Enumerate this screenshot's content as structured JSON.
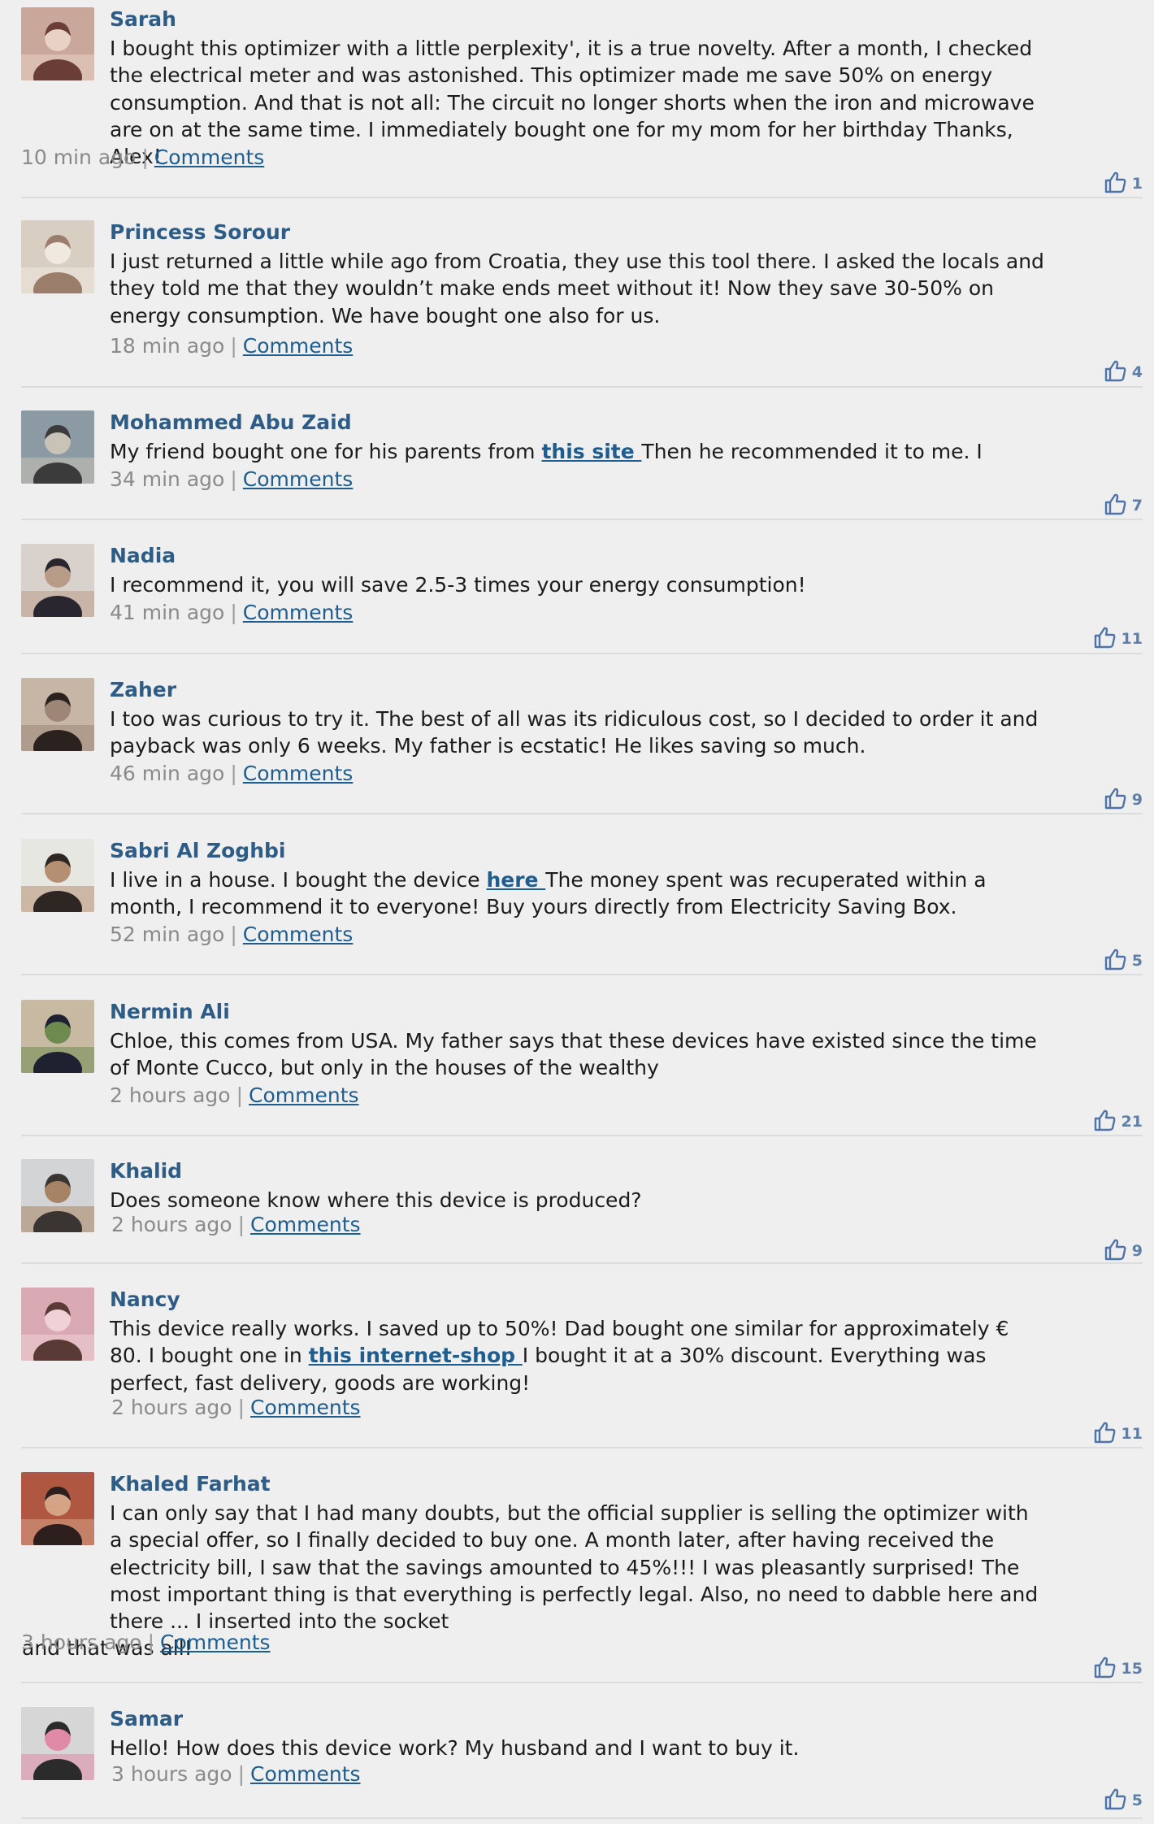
{
  "comments_label": "Comments",
  "comments": [
    {
      "author": "Sarah",
      "text": "I bought this optimizer with a little perplexity', it is a true novelty. After a month, I checked the electrical meter and was astonished. This optimizer made me save 50% on energy consumption. And that is not all: The circuit no longer shorts when the iron and microwave are on at the same time. I immediately bought one for my mom for her birthday Thanks, Alex!",
      "time": "10 min ago",
      "likes": "1"
    },
    {
      "author": "Princess Sorour",
      "text": "I just returned a little while ago from Croatia, they use this tool there. I asked the locals and they told me that they wouldn’t make ends meet without it! Now they save 30-50% on energy consumption. We have bought one also for us.",
      "time": "18 min ago",
      "likes": "4"
    },
    {
      "author": "Mohammed Abu Zaid",
      "text_before": "My friend bought one for his parents from ",
      "link": "this site ",
      "text_after": "Then he recommended it to me. I",
      "time": "34 min ago",
      "likes": "7"
    },
    {
      "author": "Nadia",
      "text": "I recommend it, you will save 2.5-3 times your energy consumption!",
      "time": "41 min ago",
      "likes": "11"
    },
    {
      "author": "Zaher",
      "text": "I too was curious to try it. The best of all was its ridiculous cost, so I decided to order it and payback was only 6 weeks. My father is ecstatic! He likes saving so much.",
      "time": "46 min ago",
      "likes": "9"
    },
    {
      "author": "Sabri Al Zoghbi",
      "text_before": "I live in a house. I bought the device ",
      "link": "here ",
      "text_after": "The money spent was recuperated within a month, I recommend it to everyone! Buy yours directly from Electricity Saving Box.",
      "time": "52 min ago",
      "likes": "5"
    },
    {
      "author": "Nermin Ali",
      "text": "Chloe, this comes from USA. My father says that these devices have existed since the time of Monte Cucco, but only in the houses of the wealthy",
      "time": "2 hours ago",
      "likes": "21"
    },
    {
      "author": "Khalid",
      "text": "Does someone know where this device is produced?",
      "time": "2 hours ago",
      "likes": "9"
    },
    {
      "author": "Nancy",
      "text_before": "This device really works. I saved up to 50%! Dad bought one similar for approximately € 80. I bought one in ",
      "link": "this internet-shop ",
      "text_after": "I bought it at a 30% discount. Everything was perfect, fast delivery, goods are working!",
      "time": "2 hours ago",
      "likes": "11"
    },
    {
      "author": "Khaled Farhat",
      "text": "I can only say that I had many doubts, but the official supplier is selling the optimizer with a special offer, so I finally decided to buy one. A month later, after having received the electricity bill, I saw that the savings amounted to 45%!!! I was pleasantly surprised! The most important thing is that everything is perfectly legal. Also, no need to dabble here and there ... I inserted into the socket",
      "tail": "and that was all!",
      "time": "3 hours ago",
      "likes": "15"
    },
    {
      "author": "Samar",
      "text": "Hello! How does this device work? My husband and I want to buy it.",
      "time": "3 hours ago",
      "likes": "5"
    }
  ]
}
